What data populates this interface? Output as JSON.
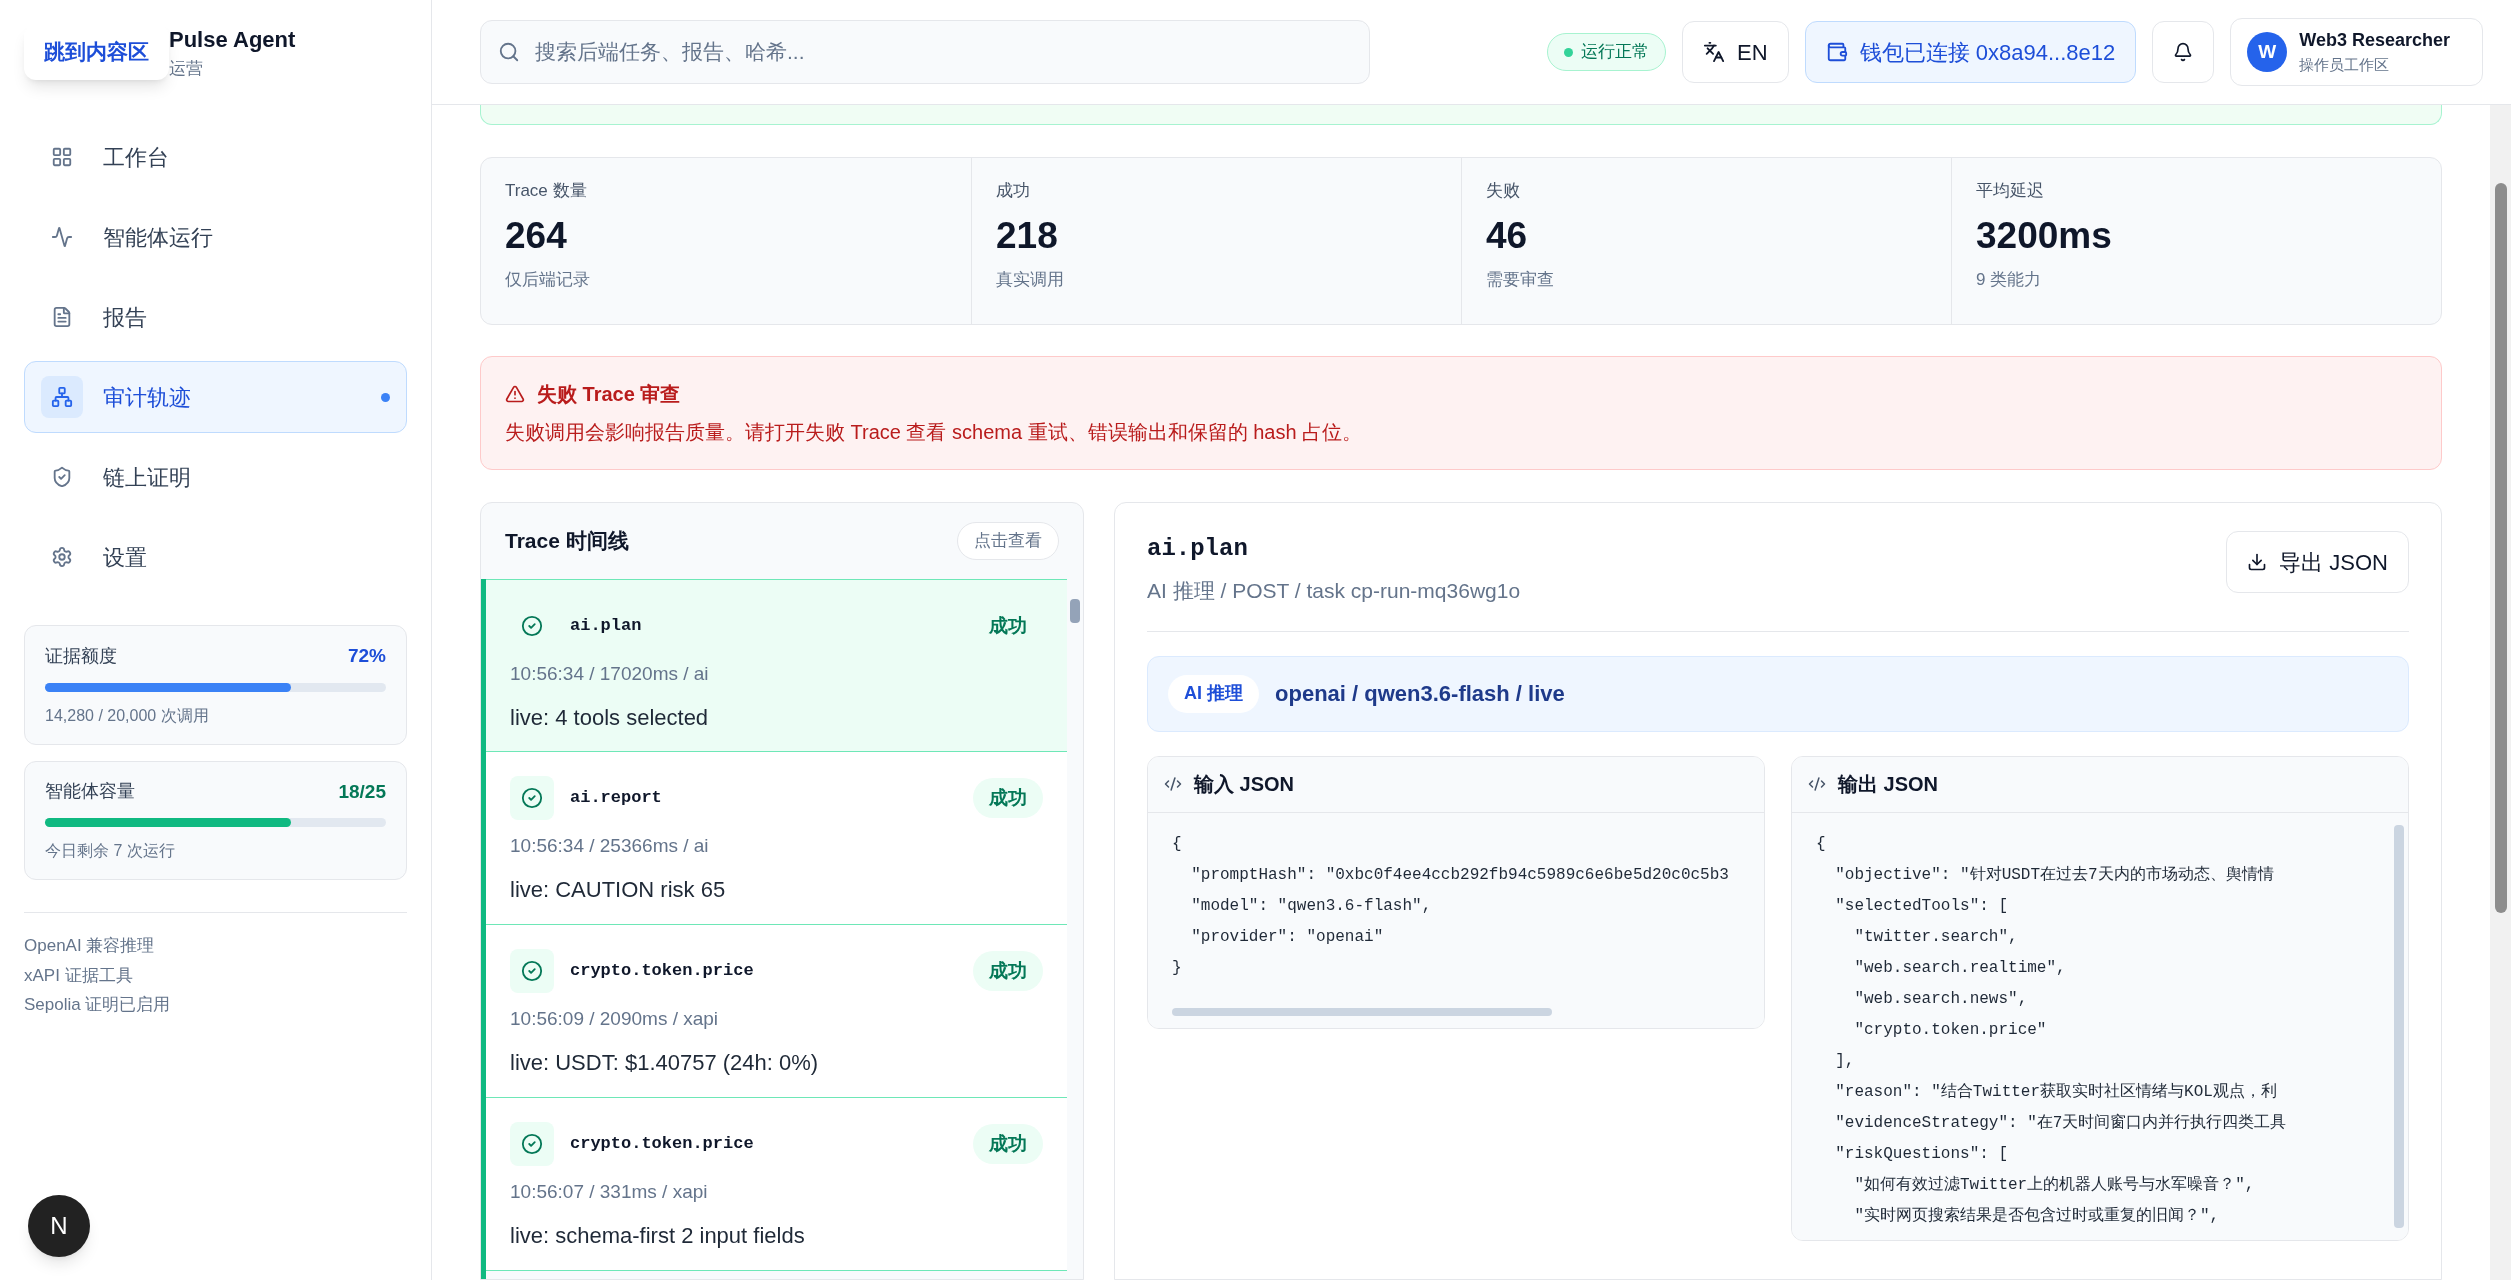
{
  "skip_link": "跳到内容区",
  "brand": {
    "title": "Pulse Agent",
    "subtitle": "运营"
  },
  "nav": [
    {
      "label": "工作台",
      "kind": "grid",
      "selected": false
    },
    {
      "label": "智能体运行",
      "kind": "pulse",
      "selected": false
    },
    {
      "label": "报告",
      "kind": "file",
      "selected": false
    },
    {
      "label": "审计轨迹",
      "kind": "network",
      "selected": true
    },
    {
      "label": "链上证明",
      "kind": "shield",
      "selected": false
    },
    {
      "label": "设置",
      "kind": "gear",
      "selected": false
    }
  ],
  "meters": [
    {
      "label": "证据额度",
      "value": "72%",
      "level": 0.72,
      "color": "#3b82f6",
      "note": "14,280 / 20,000 次调用"
    },
    {
      "label": "智能体容量",
      "value": "18/25",
      "level": 0.72,
      "color": "#10b981",
      "note": "今日剩余 7 次运行"
    }
  ],
  "footer_lines": [
    "OpenAI 兼容推理",
    "xAPI 证据工具",
    "Sepolia 证明已启用"
  ],
  "dev_badge": "N",
  "header": {
    "search_placeholder": "搜索后端任务、报告、哈希...",
    "status": "运行正常",
    "language": "EN",
    "wallet": "钱包已连接 0x8a94...8e12",
    "user": {
      "avatar": "W",
      "name": "Web3 Researcher",
      "role": "操作员工作区"
    }
  },
  "stats": [
    {
      "label": "Trace 数量",
      "value": "264",
      "note": "仅后端记录"
    },
    {
      "label": "成功",
      "value": "218",
      "note": "真实调用"
    },
    {
      "label": "失败",
      "value": "46",
      "note": "需要审查"
    },
    {
      "label": "平均延迟",
      "value": "3200ms",
      "note": "9 类能力"
    }
  ],
  "alert": {
    "title": "失败 Trace 审查",
    "text": "失败调用会影响报告质量。请打开失败 Trace 查看 schema 重试、错误输出和保留的 hash 占位。"
  },
  "timeline": {
    "title": "Trace 时间线",
    "action": "点击查看",
    "items": [
      {
        "name": "ai.plan",
        "status": "成功",
        "kind": "success",
        "meta": "10:56:34 / 17020ms / ai",
        "summary": "live: 4 tools selected",
        "selected": true
      },
      {
        "name": "ai.report",
        "status": "成功",
        "kind": "success",
        "meta": "10:56:34 / 25366ms / ai",
        "summary": "live: CAUTION risk 65",
        "selected": false
      },
      {
        "name": "crypto.token.price",
        "status": "成功",
        "kind": "success",
        "meta": "10:56:09 / 2090ms / xapi",
        "summary": "live: USDT: $1.40757 (24h: 0%)",
        "selected": false
      },
      {
        "name": "crypto.token.price",
        "status": "成功",
        "kind": "success",
        "meta": "10:56:07 / 331ms / xapi",
        "summary": "live: schema-first 2 input fields",
        "selected": false
      }
    ]
  },
  "detail": {
    "title": "ai.plan",
    "subtitle": "AI 推理 / POST / task cp-run-mq36wg1o",
    "export": "导出 JSON",
    "badge": "AI 推理",
    "model": "openai / qwen3.6-flash / live",
    "input": {
      "title": "输入 JSON",
      "lines": [
        "{",
        "  \"promptHash\": \"0xbc0f4ee4ccb292fb94c5989c6e6be5d20c0c5b3",
        "  \"model\": \"qwen3.6-flash\",",
        "  \"provider\": \"openai\"",
        "}"
      ]
    },
    "output": {
      "title": "输出 JSON",
      "lines": [
        "{",
        "  \"objective\": \"针对USDT在过去7天内的市场动态、舆情情",
        "  \"selectedTools\": [",
        "    \"twitter.search\",",
        "    \"web.search.realtime\",",
        "    \"web.search.news\",",
        "    \"crypto.token.price\"",
        "  ],",
        "  \"reason\": \"结合Twitter获取实时社区情绪与KOL观点，利",
        "  \"evidenceStrategy\": \"在7天时间窗口内并行执行四类工具",
        "  \"riskQuestions\": [",
        "    \"如何有效过滤Twitter上的机器人账号与水军噪音？\",",
        "    \"实时网页搜索结果是否包含过时或重复的旧闻？\","
      ]
    }
  }
}
